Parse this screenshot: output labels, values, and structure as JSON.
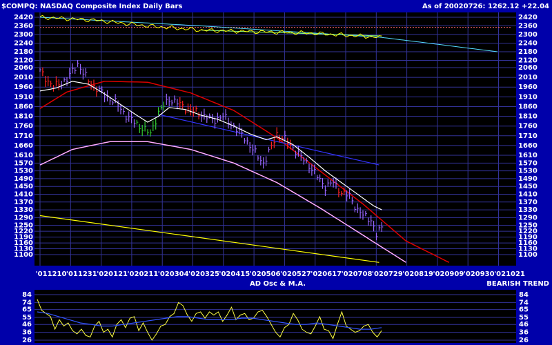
{
  "header": {
    "title": "$COMPQ: NASDAQ Composite Index Daily Bars",
    "asof": "As of 20020726: 1262.12 +22.04"
  },
  "lower_panel": {
    "title": "AD Osc & M.A.",
    "status": "BEARISH TREND"
  },
  "colors": {
    "background": "#0000aa",
    "panel": "#000000",
    "grid": "#333399",
    "axis_text": "#ffffff",
    "bar_down": "#9966ff",
    "bar_up_red": "#ff2222",
    "bar_up_green": "#33cc33",
    "ma_line": "#ffffff",
    "red_curve": "#dd0000",
    "pink_curve": "#ffaaff",
    "yellow_line": "#ffff00",
    "cyan_line": "#55ddff",
    "blue_line": "#3333ff",
    "osc_line": "#ffff44",
    "osc_ma": "#3355ff",
    "ref_line": "#ff6666"
  },
  "chart_data": [
    {
      "type": "line",
      "title": "$COMPQ: NASDAQ Composite Index Daily Bars",
      "y_ticks_upper": [
        2420,
        2360,
        2300,
        2240,
        2180,
        2120
      ],
      "y_ticks_lower": [
        2060,
        2010,
        1960,
        1910,
        1860,
        1810,
        1760,
        1710,
        1660,
        1610,
        1570,
        1530,
        1490,
        1450,
        1410,
        1370,
        1330,
        1290,
        1250,
        1220,
        1190,
        1160,
        1130,
        1100
      ],
      "x_ticks": [
        "'011210",
        "'011231",
        "'020121",
        "'020211",
        "'020304",
        "'020325",
        "'020415",
        "'020506",
        "'020527",
        "'020617",
        "'020708",
        "'020729",
        "'020819",
        "'020909",
        "'020930",
        "'021021"
      ],
      "ylim": [
        1060,
        2080
      ],
      "price_path": [
        [
          0,
          2040
        ],
        [
          5,
          1960
        ],
        [
          10,
          2000
        ],
        [
          14,
          2080
        ],
        [
          18,
          1990
        ],
        [
          23,
          1930
        ],
        [
          28,
          1880
        ],
        [
          33,
          1800
        ],
        [
          37,
          1760
        ],
        [
          41,
          1720
        ],
        [
          44,
          1830
        ],
        [
          48,
          1900
        ],
        [
          52,
          1870
        ],
        [
          56,
          1840
        ],
        [
          60,
          1820
        ],
        [
          64,
          1790
        ],
        [
          68,
          1810
        ],
        [
          72,
          1760
        ],
        [
          76,
          1700
        ],
        [
          80,
          1620
        ],
        [
          83,
          1570
        ],
        [
          86,
          1650
        ],
        [
          88,
          1720
        ],
        [
          91,
          1690
        ],
        [
          94,
          1650
        ],
        [
          97,
          1600
        ],
        [
          100,
          1560
        ],
        [
          103,
          1500
        ],
        [
          106,
          1450
        ],
        [
          109,
          1470
        ],
        [
          112,
          1420
        ],
        [
          115,
          1400
        ],
        [
          118,
          1330
        ],
        [
          120,
          1300
        ],
        [
          123,
          1280
        ],
        [
          125,
          1200
        ],
        [
          127,
          1240
        ]
      ],
      "ma_path": [
        [
          0,
          1940
        ],
        [
          6,
          1955
        ],
        [
          12,
          1990
        ],
        [
          18,
          1975
        ],
        [
          24,
          1925
        ],
        [
          30,
          1870
        ],
        [
          36,
          1815
        ],
        [
          40,
          1780
        ],
        [
          44,
          1810
        ],
        [
          48,
          1855
        ],
        [
          54,
          1845
        ],
        [
          60,
          1815
        ],
        [
          66,
          1795
        ],
        [
          72,
          1760
        ],
        [
          78,
          1720
        ],
        [
          84,
          1690
        ],
        [
          88,
          1705
        ],
        [
          94,
          1665
        ],
        [
          100,
          1600
        ],
        [
          106,
          1530
        ],
        [
          112,
          1470
        ],
        [
          118,
          1410
        ],
        [
          124,
          1350
        ],
        [
          127,
          1330
        ]
      ],
      "red_curve": [
        [
          0,
          1850
        ],
        [
          10,
          1935
        ],
        [
          24,
          1990
        ],
        [
          40,
          1985
        ],
        [
          56,
          1930
        ],
        [
          72,
          1840
        ],
        [
          88,
          1700
        ],
        [
          104,
          1530
        ],
        [
          120,
          1360
        ],
        [
          136,
          1170
        ],
        [
          152,
          1060
        ]
      ],
      "pink_curve": [
        [
          0,
          1560
        ],
        [
          12,
          1640
        ],
        [
          26,
          1680
        ],
        [
          40,
          1680
        ],
        [
          56,
          1640
        ],
        [
          72,
          1570
        ],
        [
          88,
          1470
        ],
        [
          104,
          1340
        ],
        [
          120,
          1200
        ],
        [
          136,
          1060
        ]
      ],
      "yellow_line": [
        [
          0,
          1300
        ],
        [
          126,
          1060
        ]
      ],
      "blue_line": [
        [
          44,
          1820
        ],
        [
          126,
          1560
        ]
      ],
      "overlay_upper": {
        "yellow": [
          [
            0,
            2420
          ],
          [
            20,
            2400
          ],
          [
            40,
            2360
          ],
          [
            60,
            2330
          ],
          [
            80,
            2320
          ],
          [
            100,
            2310
          ],
          [
            127,
            2280
          ]
        ],
        "cyan": [
          [
            0,
            2420
          ],
          [
            60,
            2360
          ],
          [
            127,
            2280
          ],
          [
            170,
            2180
          ]
        ],
        "pink_ref": [
          [
            0,
            2350
          ],
          [
            175,
            2350
          ]
        ],
        "green": [
          [
            60,
            2330
          ],
          [
            127,
            2290
          ]
        ]
      }
    },
    {
      "type": "line",
      "title": "AD Osc & M.A.",
      "y_ticks": [
        84,
        74,
        65,
        55,
        46,
        36,
        26
      ],
      "ylim": [
        24,
        88
      ],
      "osc": [
        78,
        64,
        60,
        56,
        40,
        52,
        44,
        48,
        38,
        34,
        40,
        32,
        30,
        44,
        50,
        36,
        40,
        30,
        46,
        52,
        42,
        54,
        56,
        38,
        48,
        36,
        26,
        34,
        44,
        46,
        56,
        60,
        74,
        70,
        58,
        50,
        60,
        62,
        54,
        62,
        58,
        62,
        50,
        58,
        68,
        52,
        58,
        60,
        52,
        54,
        62,
        64,
        56,
        46,
        36,
        30,
        42,
        46,
        60,
        52,
        40,
        36,
        34,
        44,
        56,
        40,
        38,
        28,
        46,
        62,
        44,
        40,
        36,
        38,
        44,
        46,
        36,
        30,
        38
      ],
      "osc_ma": [
        62,
        60,
        56,
        52,
        48,
        46,
        44,
        44,
        46,
        48,
        50,
        52,
        54,
        56,
        56,
        54,
        52,
        52,
        52,
        54,
        54,
        52,
        50,
        48,
        46,
        46,
        48,
        46,
        44,
        42,
        40,
        40,
        42
      ]
    }
  ]
}
